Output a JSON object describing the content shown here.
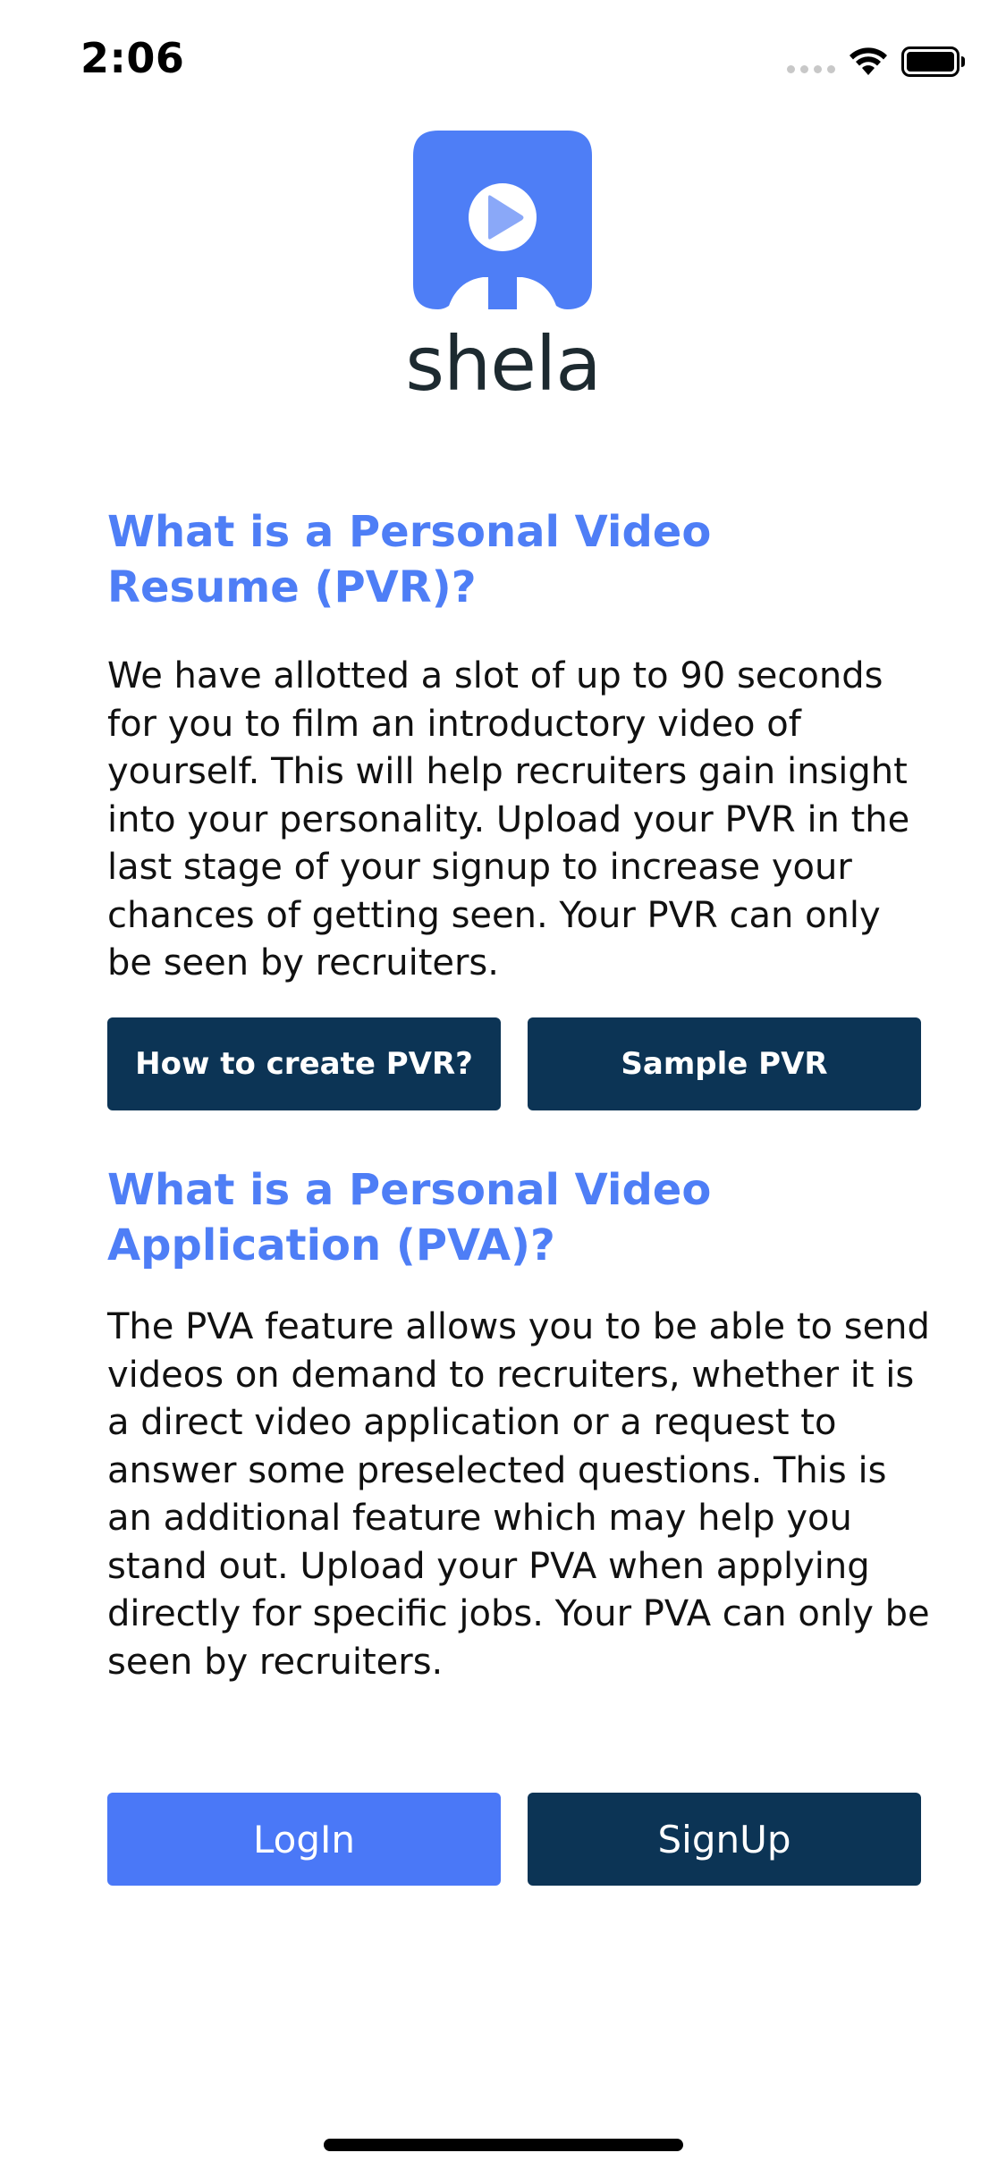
{
  "status_bar": {
    "time": "2:06"
  },
  "brand": {
    "name": "shela",
    "logo_icon": "play-video-icon",
    "logo_color": "#4e7ef6"
  },
  "pvr": {
    "title": "What is a Personal Video Resume (PVR)?",
    "description": "We have allotted a slot of up to 90 seconds for you to film an introductory video of yourself. This will help recruiters gain insight into your personality. Upload your PVR in the last stage of your signup to increase your chances of getting seen. Your PVR can only be seen by recruiters.",
    "how_to_label": "How to create PVR?",
    "sample_label": "Sample PVR"
  },
  "pva": {
    "title": "What is a Personal Video Application (PVA)?",
    "description": "The PVA feature allows you to be able to send videos on demand to recruiters, whether it is a direct video application or a request to answer some preselected questions. This is an additional feature which may help you stand out. Upload your PVA when applying directly for specific jobs. Your PVA can only be seen by recruiters."
  },
  "auth": {
    "login_label": "LogIn",
    "signup_label": "SignUp"
  },
  "colors": {
    "accent": "#4e7ef6",
    "dark_button": "#0c3455",
    "login_button": "#4a78f7"
  }
}
